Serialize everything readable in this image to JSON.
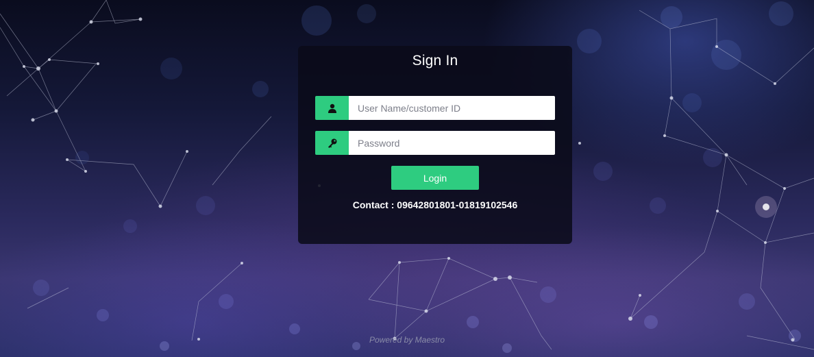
{
  "login": {
    "title": "Sign In",
    "username": {
      "placeholder": "User Name/customer ID",
      "value": "",
      "icon": "user-icon"
    },
    "password": {
      "placeholder": "Password",
      "value": "",
      "icon": "key-icon"
    },
    "button_label": "Login",
    "contact": "Contact : 09642801801-01819102546"
  },
  "footer": {
    "powered_by": "Powered by Maestro"
  },
  "colors": {
    "accent": "#2ecc80",
    "panel_bg": "#0a0b18",
    "text": "#ffffff"
  }
}
